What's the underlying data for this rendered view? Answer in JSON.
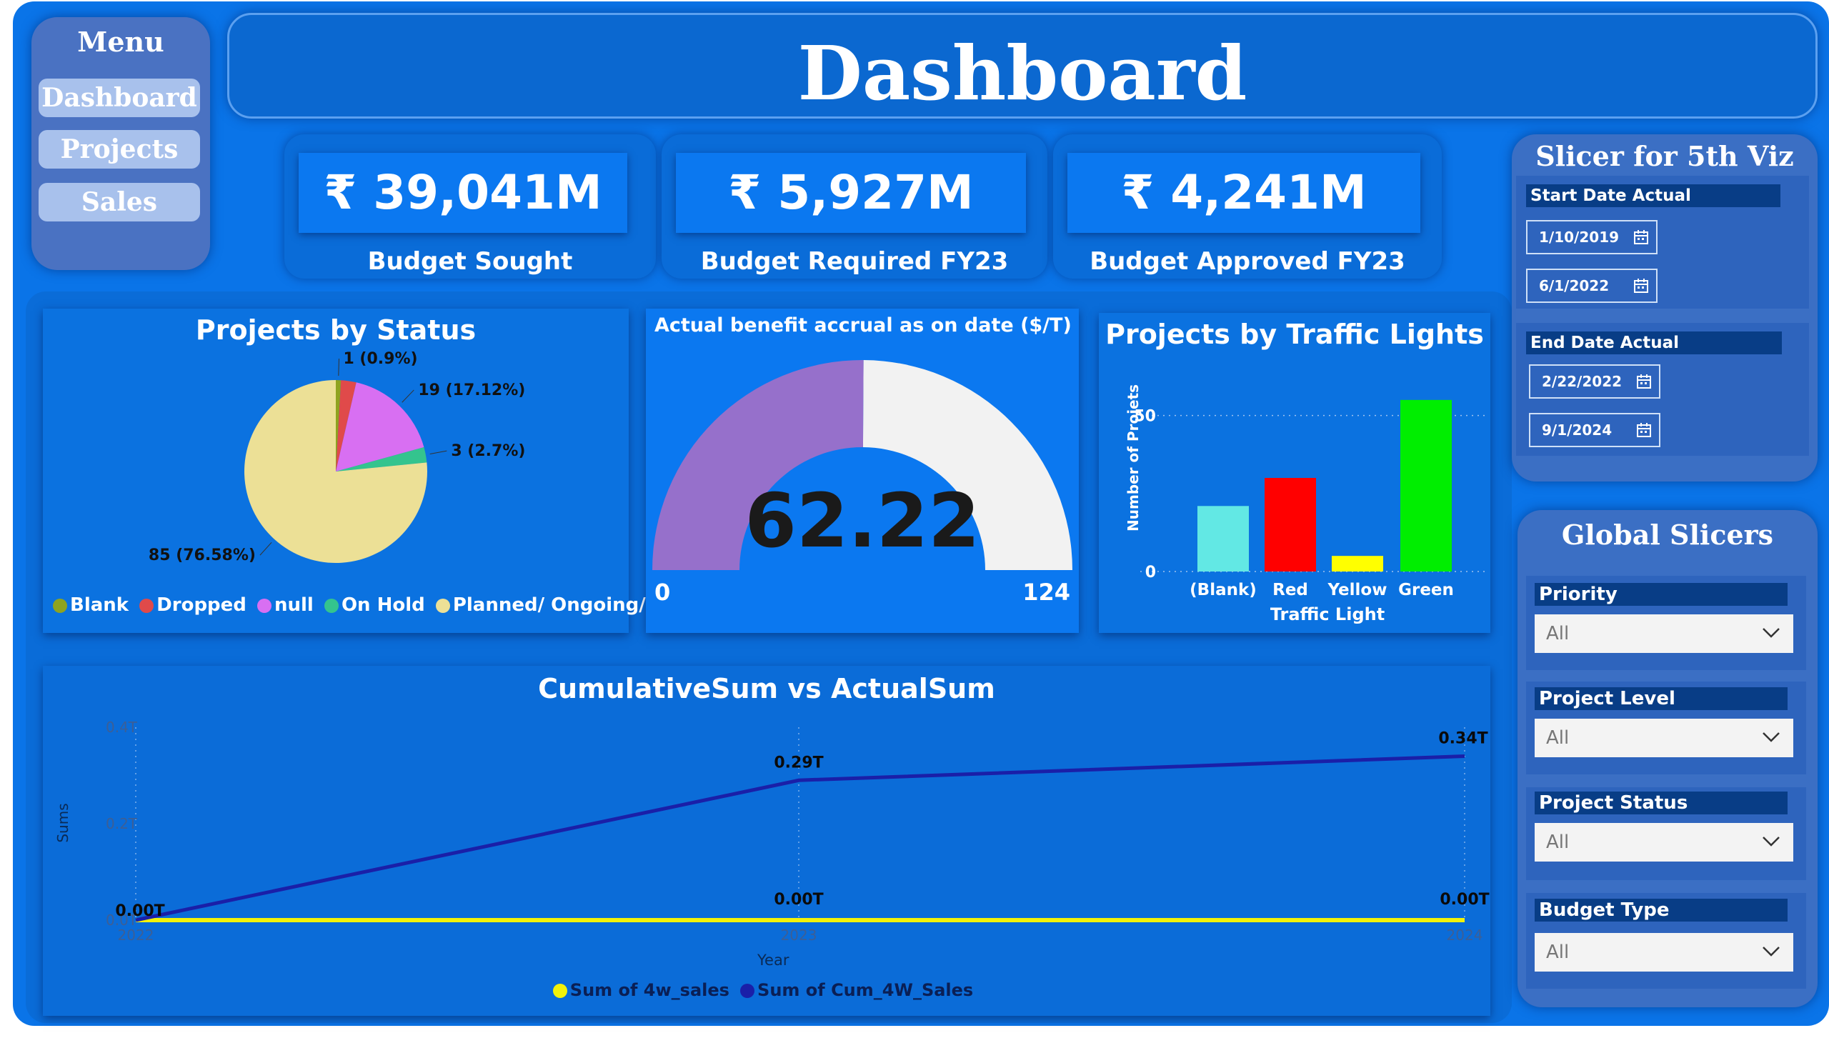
{
  "menu": {
    "title": "Menu",
    "items": [
      "Dashboard",
      "Projects",
      "Sales"
    ]
  },
  "header": {
    "title": "Dashboard"
  },
  "kpis": [
    {
      "value": "₹ 39,041M",
      "label": "Budget Sought"
    },
    {
      "value": "₹ 5,927M",
      "label": "Budget Required FY23"
    },
    {
      "value": "₹ 4,241M",
      "label": "Budget Approved FY23"
    }
  ],
  "status_chart": {
    "title": "Projects by Status",
    "legend": [
      "Blank",
      "Dropped",
      "null",
      "On Hold",
      "Planned/ Ongoing/ ..."
    ],
    "colors": [
      "#8fa31f",
      "#e04a4a",
      "#d86ff2",
      "#34c48e",
      "#ece096"
    ]
  },
  "gauge": {
    "title": "Actual benefit accrual as on date ($/T)",
    "value": 62.22,
    "value_label": "62.22",
    "min": "0",
    "max": "124",
    "max_value": 124,
    "fill_color": "#9670cb",
    "rest_color": "#f2f2f2"
  },
  "traffic_chart": {
    "title": "Projects by Traffic Lights",
    "ylabel": "Number of Projets",
    "xlabel": "Traffic Light",
    "ytick_top": "50",
    "ytick_zero": "0"
  },
  "line_chart": {
    "title": "CumulativeSum vs ActualSum",
    "ylabel": "Sums",
    "xlabel": "Year",
    "yticks": [
      "0.4T",
      "0.2T",
      "0.0T"
    ],
    "xticks": [
      "2022",
      "2023",
      "2024"
    ],
    "legend": [
      "Sum of 4w_sales",
      "Sum of Cum_4W_Sales"
    ],
    "legend_colors": [
      "#f2f20a",
      "#1a1fa8"
    ]
  },
  "slicer5": {
    "title": "Slicer for 5th Viz",
    "start_label": "Start Date Actual",
    "start_from": "1/10/2019",
    "start_to": "6/1/2022",
    "end_label": "End Date Actual",
    "end_from": "2/22/2022",
    "end_to": "9/1/2024"
  },
  "global": {
    "title": "Global Slicers",
    "filters": [
      {
        "label": "Priority",
        "value": "All"
      },
      {
        "label": "Project Level",
        "value": "All"
      },
      {
        "label": "Project Status",
        "value": "All"
      },
      {
        "label": "Budget Type",
        "value": "All"
      }
    ]
  },
  "chart_data": [
    {
      "type": "pie",
      "title": "Projects by Status",
      "categories": [
        "Blank",
        "Dropped",
        "null",
        "On Hold",
        "Planned/ Ongoing/ ..."
      ],
      "values": [
        1,
        3,
        19,
        3,
        85
      ],
      "data_labels": [
        "1 (0.9%)",
        "",
        "19 (17.12%)",
        "3 (2.7%)",
        "85 (76.58%)"
      ],
      "legend": "bottom"
    },
    {
      "type": "bar",
      "title": "Projects by Traffic Lights",
      "categories": [
        "(Blank)",
        "Red",
        "Yellow",
        "Green"
      ],
      "values": [
        21,
        30,
        5,
        55
      ],
      "colors": [
        "#62e8e4",
        "#ff0000",
        "#ffff00",
        "#00ee00"
      ],
      "xlabel": "Traffic Light",
      "ylabel": "Number of Projets",
      "ylim": [
        0,
        60
      ],
      "grid": true
    },
    {
      "type": "line",
      "title": "CumulativeSum vs ActualSum",
      "categories": [
        "2022",
        "2023",
        "2024"
      ],
      "series": [
        {
          "name": "Sum of 4w_sales",
          "values": [
            0.0,
            0.0,
            0.0
          ],
          "labels": [
            "0.00T",
            "0.00T",
            "0.00T"
          ]
        },
        {
          "name": "Sum of Cum_4W_Sales",
          "values": [
            0.0,
            0.29,
            0.34
          ],
          "labels": [
            "0.00T",
            "0.29T",
            "0.34T"
          ]
        }
      ],
      "xlabel": "Year",
      "ylabel": "Sums",
      "ylim": [
        0,
        0.4
      ],
      "legend": "bottom"
    }
  ]
}
